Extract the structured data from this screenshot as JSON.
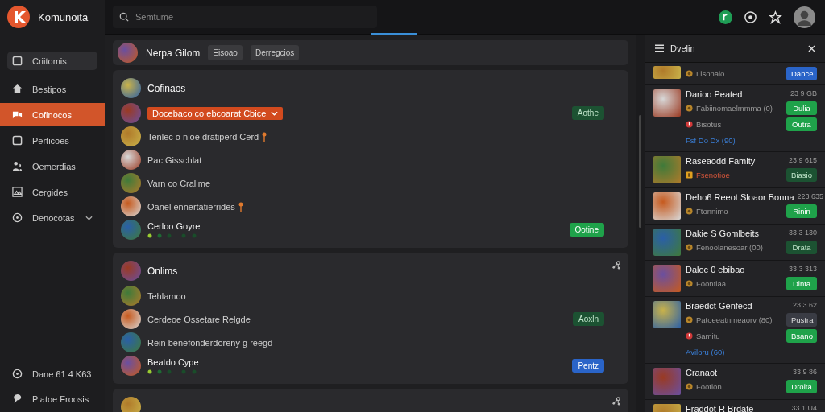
{
  "app": {
    "name": "Komunoita"
  },
  "sidebar": {
    "items": [
      {
        "label": "Criitomis",
        "selected": false,
        "highlighted": true
      },
      {
        "label": "Bestipos",
        "selected": false,
        "highlighted": false
      },
      {
        "label": "Cofinocos",
        "selected": true,
        "highlighted": false
      },
      {
        "label": "Perticoes",
        "selected": false,
        "highlighted": false
      },
      {
        "label": "Oemerdias",
        "selected": false,
        "highlighted": false
      },
      {
        "label": "Cergides",
        "selected": false,
        "highlighted": false
      },
      {
        "label": "Denocotas",
        "selected": false,
        "highlighted": false,
        "expanded": false
      }
    ],
    "footer": [
      {
        "label": "Dane 61 4 K63"
      },
      {
        "label": "Piatoe Froosis"
      }
    ]
  },
  "search": {
    "placeholder": "Semtume"
  },
  "header": {
    "title": "Nerpa Gilom",
    "chips": [
      "Eisoao",
      "Derregcios"
    ]
  },
  "cards": [
    {
      "title": "Cofinaos",
      "corner_icon": false,
      "rows": [
        {
          "kind": "dropdown",
          "text": "Docebaco co ebcoarat Cbice",
          "pinned": false,
          "button": {
            "label": "Aothe",
            "kind": "muted"
          }
        },
        {
          "kind": "text",
          "text": "Tenlec o nloe dratiperd Cerd",
          "pinned": true
        },
        {
          "kind": "text",
          "text": "Pac Gisschlat",
          "pinned": false
        },
        {
          "kind": "text",
          "text": "Varn co Cralime",
          "pinned": false
        },
        {
          "kind": "text",
          "text": "Oanel ennertatierrides",
          "pinned": true
        },
        {
          "kind": "status",
          "text": "Cerloo Goyre",
          "pinned": false,
          "button": {
            "label": "Ootine",
            "kind": "green"
          }
        }
      ]
    },
    {
      "title": "Onlims",
      "corner_icon": true,
      "rows": [
        {
          "kind": "text",
          "text": "Tehlamoo",
          "pinned": false
        },
        {
          "kind": "text",
          "text": "Cerdeoe Ossetare Relgde",
          "pinned": false,
          "button": {
            "label": "Aoxln",
            "kind": "muted"
          }
        },
        {
          "kind": "text",
          "text": "Rein benefonderdoreny g reegd",
          "pinned": false
        },
        {
          "kind": "status",
          "text": "Beatdo Cype",
          "pinned": false,
          "button": {
            "label": "Pentz",
            "kind": "blue"
          }
        }
      ]
    },
    {
      "corner_icon": true
    }
  ],
  "panel": {
    "title": "Dvelin",
    "items": [
      {
        "lines": [
          {
            "kind": "coin",
            "text": "Lisonaio",
            "button": {
              "label": "Dance",
              "kind": "blue"
            }
          }
        ]
      },
      {
        "name": "Darioo Peated",
        "time": "23 9 GB",
        "lines": [
          {
            "kind": "coin",
            "text": "Fabiinomaelmmma (0)",
            "button": {
              "label": "Dulia",
              "kind": "green"
            }
          },
          {
            "kind": "alert",
            "text": "Bisotus",
            "button": {
              "label": "Outra",
              "kind": "green"
            }
          },
          {
            "kind": "link",
            "text": "Fsf Do Dx (90)"
          }
        ]
      },
      {
        "name": "Raseaodd Famity",
        "time": "23 9 615",
        "lines": [
          {
            "kind": "flag",
            "text": "Fsenotioe",
            "button": {
              "label": "Biasio",
              "kind": "muted"
            }
          }
        ]
      },
      {
        "name": "Deho6 Reeot Sloaor Bonna",
        "time": "223 635",
        "lines": [
          {
            "kind": "coin",
            "text": "Ftonnimo",
            "button": {
              "label": "Rinin",
              "kind": "green"
            }
          }
        ]
      },
      {
        "name": "Dakie S Gomlbeits",
        "time": "33 3 130",
        "lines": [
          {
            "kind": "coin",
            "text": "Fenoolanesoar (00)",
            "button": {
              "label": "Drata",
              "kind": "muted"
            }
          }
        ]
      },
      {
        "name": "Daloc 0 ebibao",
        "time": "33 3 313",
        "lines": [
          {
            "kind": "coin",
            "text": "Foontiaa",
            "button": {
              "label": "Dinta",
              "kind": "green"
            }
          }
        ]
      },
      {
        "name": "Braedct Genfecd",
        "time": "23 3 62",
        "lines": [
          {
            "kind": "coin",
            "text": "Patoeeatnmeaorv (80)",
            "button": {
              "label": "Pustra",
              "kind": "gray"
            }
          },
          {
            "kind": "alert",
            "text": "Samitu",
            "button": {
              "label": "Bsano",
              "kind": "green"
            }
          },
          {
            "kind": "link",
            "text": "Aviloru (60)"
          }
        ]
      },
      {
        "name": "Cranaot",
        "time": "33 9 86",
        "lines": [
          {
            "kind": "coin",
            "text": "Footion",
            "button": {
              "label": "Droita",
              "kind": "green"
            }
          }
        ]
      },
      {
        "name": "Fraddot R Brdate",
        "time": "33 1 U4"
      }
    ]
  }
}
